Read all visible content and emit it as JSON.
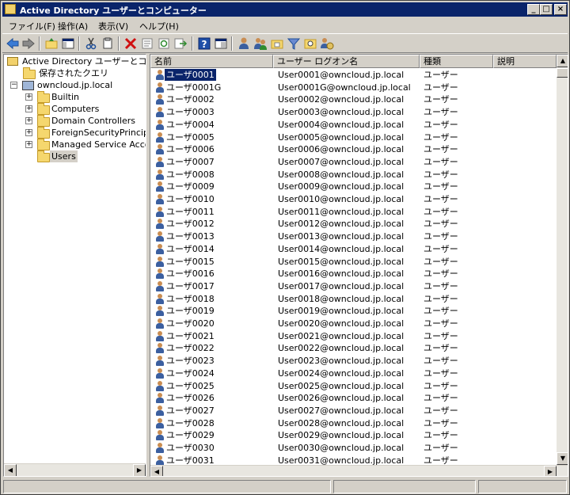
{
  "window": {
    "title": "Active Directory ユーザーとコンピューター"
  },
  "title_buttons": {
    "minimize": "_",
    "maximize": "□",
    "close": "×"
  },
  "menu": [
    {
      "label": "ファイル(F)"
    },
    {
      "label": "操作(A)"
    },
    {
      "label": "表示(V)"
    },
    {
      "label": "ヘルプ(H)"
    }
  ],
  "toolbar": [
    "back-arrow-icon",
    "forward-arrow-icon",
    "up-folder-icon",
    "show-console-tree-icon",
    "cut-icon",
    "copy-icon",
    "delete-icon",
    "properties-icon",
    "refresh-icon",
    "export-list-icon",
    "help-icon",
    "console-view-icon",
    "new-user-icon",
    "new-group-icon",
    "new-ou-icon",
    "filter-icon",
    "find-icon",
    "add-to-group-icon"
  ],
  "tree": {
    "root": "Active Directory ユーザーとコンピュ",
    "saved_queries": "保存されたクエリ",
    "domain": "owncloud.jp.local",
    "children": [
      "Builtin",
      "Computers",
      "Domain Controllers",
      "ForeignSecurityPrincipals",
      "Managed Service Account",
      "Users"
    ],
    "selected": "Users"
  },
  "list": {
    "columns": [
      "名前",
      "ユーザー ログオン名",
      "種類",
      "説明"
    ],
    "rows": [
      {
        "name": "ユーザ0001",
        "logon": "User0001@owncloud.jp.local",
        "type": "ユーザー"
      },
      {
        "name": "ユーザ0001G",
        "logon": "User0001G@owncloud.jp.local",
        "type": "ユーザー"
      },
      {
        "name": "ユーザ0002",
        "logon": "User0002@owncloud.jp.local",
        "type": "ユーザー"
      },
      {
        "name": "ユーザ0003",
        "logon": "User0003@owncloud.jp.local",
        "type": "ユーザー"
      },
      {
        "name": "ユーザ0004",
        "logon": "User0004@owncloud.jp.local",
        "type": "ユーザー"
      },
      {
        "name": "ユーザ0005",
        "logon": "User0005@owncloud.jp.local",
        "type": "ユーザー"
      },
      {
        "name": "ユーザ0006",
        "logon": "User0006@owncloud.jp.local",
        "type": "ユーザー"
      },
      {
        "name": "ユーザ0007",
        "logon": "User0007@owncloud.jp.local",
        "type": "ユーザー"
      },
      {
        "name": "ユーザ0008",
        "logon": "User0008@owncloud.jp.local",
        "type": "ユーザー"
      },
      {
        "name": "ユーザ0009",
        "logon": "User0009@owncloud.jp.local",
        "type": "ユーザー"
      },
      {
        "name": "ユーザ0010",
        "logon": "User0010@owncloud.jp.local",
        "type": "ユーザー"
      },
      {
        "name": "ユーザ0011",
        "logon": "User0011@owncloud.jp.local",
        "type": "ユーザー"
      },
      {
        "name": "ユーザ0012",
        "logon": "User0012@owncloud.jp.local",
        "type": "ユーザー"
      },
      {
        "name": "ユーザ0013",
        "logon": "User0013@owncloud.jp.local",
        "type": "ユーザー"
      },
      {
        "name": "ユーザ0014",
        "logon": "User0014@owncloud.jp.local",
        "type": "ユーザー"
      },
      {
        "name": "ユーザ0015",
        "logon": "User0015@owncloud.jp.local",
        "type": "ユーザー"
      },
      {
        "name": "ユーザ0016",
        "logon": "User0016@owncloud.jp.local",
        "type": "ユーザー"
      },
      {
        "name": "ユーザ0017",
        "logon": "User0017@owncloud.jp.local",
        "type": "ユーザー"
      },
      {
        "name": "ユーザ0018",
        "logon": "User0018@owncloud.jp.local",
        "type": "ユーザー"
      },
      {
        "name": "ユーザ0019",
        "logon": "User0019@owncloud.jp.local",
        "type": "ユーザー"
      },
      {
        "name": "ユーザ0020",
        "logon": "User0020@owncloud.jp.local",
        "type": "ユーザー"
      },
      {
        "name": "ユーザ0021",
        "logon": "User0021@owncloud.jp.local",
        "type": "ユーザー"
      },
      {
        "name": "ユーザ0022",
        "logon": "User0022@owncloud.jp.local",
        "type": "ユーザー"
      },
      {
        "name": "ユーザ0023",
        "logon": "User0023@owncloud.jp.local",
        "type": "ユーザー"
      },
      {
        "name": "ユーザ0024",
        "logon": "User0024@owncloud.jp.local",
        "type": "ユーザー"
      },
      {
        "name": "ユーザ0025",
        "logon": "User0025@owncloud.jp.local",
        "type": "ユーザー"
      },
      {
        "name": "ユーザ0026",
        "logon": "User0026@owncloud.jp.local",
        "type": "ユーザー"
      },
      {
        "name": "ユーザ0027",
        "logon": "User0027@owncloud.jp.local",
        "type": "ユーザー"
      },
      {
        "name": "ユーザ0028",
        "logon": "User0028@owncloud.jp.local",
        "type": "ユーザー"
      },
      {
        "name": "ユーザ0029",
        "logon": "User0029@owncloud.jp.local",
        "type": "ユーザー"
      },
      {
        "name": "ユーザ0030",
        "logon": "User0030@owncloud.jp.local",
        "type": "ユーザー"
      },
      {
        "name": "ユーザ0031",
        "logon": "User0031@owncloud.jp.local",
        "type": "ユーザー"
      }
    ]
  },
  "colors": {
    "titlebar": "#0a246a",
    "selection": "#0a246a",
    "face": "#d4d0c8"
  }
}
